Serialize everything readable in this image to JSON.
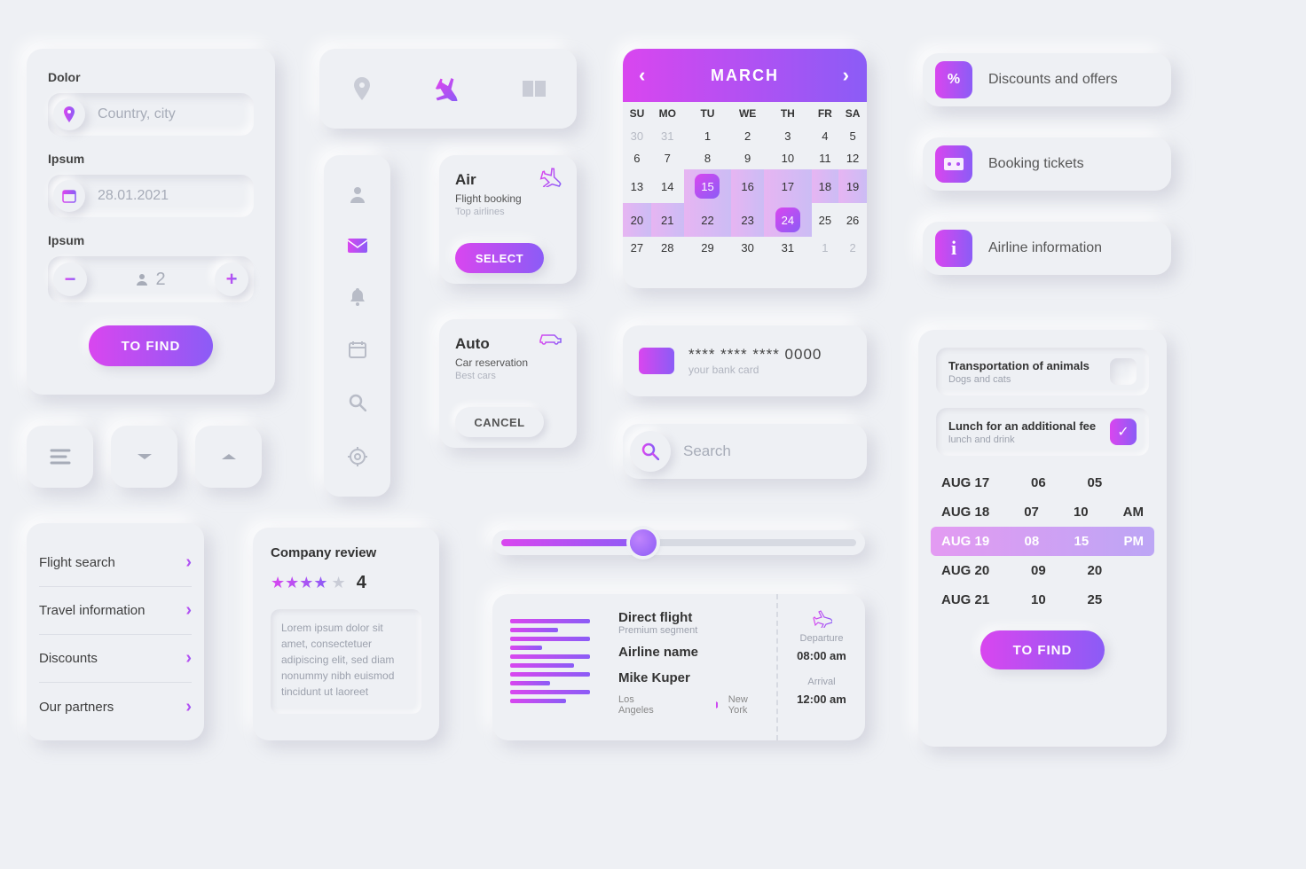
{
  "search": {
    "label_location": "Dolor",
    "placeholder_location": "Country, city",
    "label_date": "Ipsum",
    "date_value": "28.01.2021",
    "label_pax": "Ipsum",
    "pax_value": "2",
    "find_btn": "TO FIND"
  },
  "links": [
    "Flight search",
    "Travel information",
    "Discounts",
    "Our partners"
  ],
  "svc_air": {
    "title": "Air",
    "sub": "Flight booking",
    "sub2": "Top airlines",
    "btn": "SELECT"
  },
  "svc_auto": {
    "title": "Auto",
    "sub": "Car reservation",
    "sub2": "Best cars",
    "btn": "CANCEL"
  },
  "calendar": {
    "month": "MARCH",
    "dow": [
      "SU",
      "MO",
      "TU",
      "WE",
      "TH",
      "FR",
      "SA"
    ],
    "grid": [
      [
        {
          "d": "30",
          "mut": true
        },
        {
          "d": "31",
          "mut": true
        },
        {
          "d": "1"
        },
        {
          "d": "2"
        },
        {
          "d": "3"
        },
        {
          "d": "4"
        },
        {
          "d": "5"
        }
      ],
      [
        {
          "d": "6"
        },
        {
          "d": "7"
        },
        {
          "d": "8"
        },
        {
          "d": "9"
        },
        {
          "d": "10"
        },
        {
          "d": "11"
        },
        {
          "d": "12"
        }
      ],
      [
        {
          "d": "13"
        },
        {
          "d": "14"
        },
        {
          "d": "15",
          "sel": true,
          "range": true
        },
        {
          "d": "16",
          "range": true
        },
        {
          "d": "17",
          "range": true
        },
        {
          "d": "18",
          "range": true
        },
        {
          "d": "19",
          "range": true
        }
      ],
      [
        {
          "d": "20",
          "range": true
        },
        {
          "d": "21",
          "range": true
        },
        {
          "d": "22",
          "range": true
        },
        {
          "d": "23",
          "range": true
        },
        {
          "d": "24",
          "sel": true,
          "range": true
        },
        {
          "d": "25"
        },
        {
          "d": "26"
        }
      ],
      [
        {
          "d": "27"
        },
        {
          "d": "28"
        },
        {
          "d": "29"
        },
        {
          "d": "30"
        },
        {
          "d": "31"
        },
        {
          "d": "1",
          "mut": true
        },
        {
          "d": "2",
          "mut": true
        }
      ]
    ]
  },
  "cc": {
    "mask": "**** **** **** 0000",
    "hint": "your bank card"
  },
  "search_bar": {
    "placeholder": "Search"
  },
  "review": {
    "title": "Company review",
    "rating": "4",
    "lorem": "Lorem ipsum dolor sit amet, consectetuer adipiscing elit, sed diam nonummy nibh euismod tincidunt ut laoreet"
  },
  "ticket": {
    "h": "Direct flight",
    "seg": "Premium segment",
    "airline": "Airline name",
    "pax": "Mike Kuper",
    "from": "Los Angeles",
    "to": "New York",
    "dep_l": "Departure",
    "dep_t": "08:00 am",
    "arr_l": "Arrival",
    "arr_t": "12:00 am"
  },
  "chips": [
    "Discounts and offers",
    "Booking tickets",
    "Airline information"
  ],
  "picker": {
    "opt1": {
      "t": "Transportation of animals",
      "s": "Dogs and cats"
    },
    "opt2": {
      "t": "Lunch for an additional fee",
      "s": "lunch and drink"
    },
    "rows": [
      [
        "AUG 17",
        "06",
        "05",
        ""
      ],
      [
        "AUG 18",
        "07",
        "10",
        "AM"
      ],
      [
        "AUG 19",
        "08",
        "15",
        "PM"
      ],
      [
        "AUG 20",
        "09",
        "20",
        ""
      ],
      [
        "AUG 21",
        "10",
        "25",
        ""
      ]
    ],
    "sel_index": 2,
    "btn": "TO FIND"
  }
}
